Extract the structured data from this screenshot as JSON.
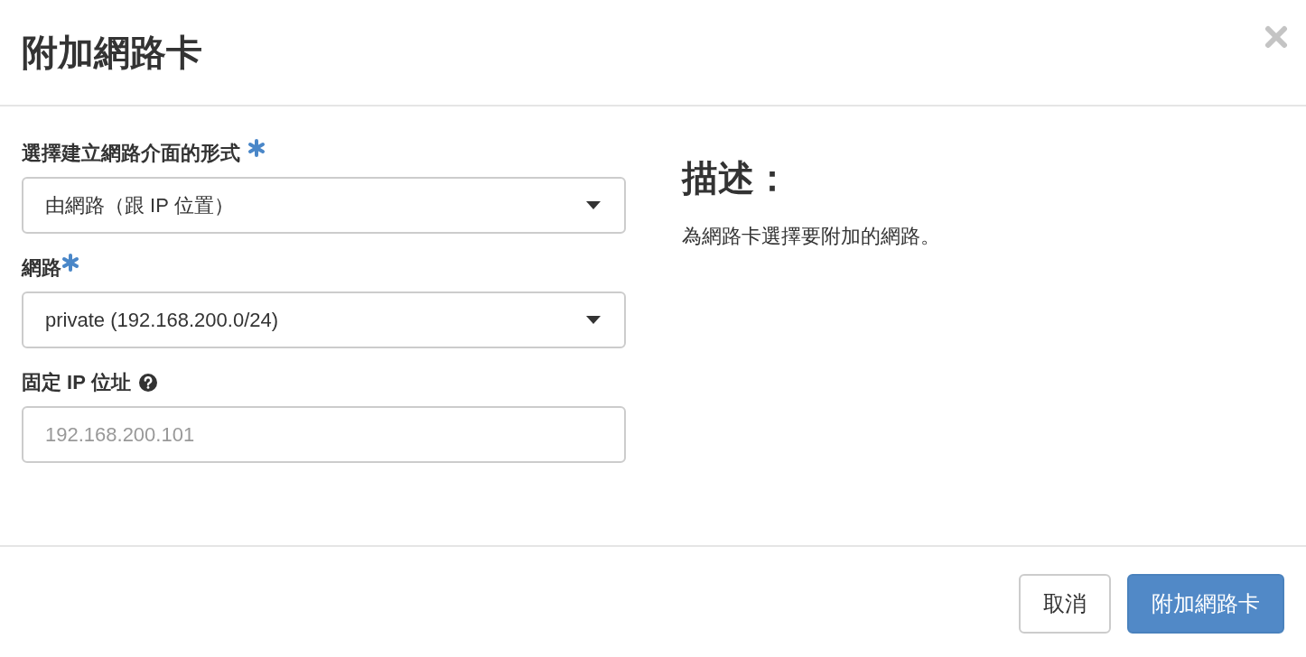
{
  "dialog": {
    "title": "附加網路卡"
  },
  "fields": [
    {
      "kind": "select",
      "label": "選擇建立網路介面的形式",
      "required": true,
      "value": "由網路（跟 IP 位置）"
    },
    {
      "kind": "select",
      "label": "網路",
      "required": true,
      "value": "private (192.168.200.0/24)"
    },
    {
      "kind": "text",
      "label": "固定 IP 位址",
      "help": true,
      "placeholder": "192.168.200.101"
    }
  ],
  "description": {
    "heading": "描述：",
    "text": "為網路卡選擇要附加的網路。"
  },
  "buttons": [
    {
      "label": "取消",
      "kind": "default"
    },
    {
      "label": "附加網路卡",
      "kind": "primary"
    }
  ]
}
